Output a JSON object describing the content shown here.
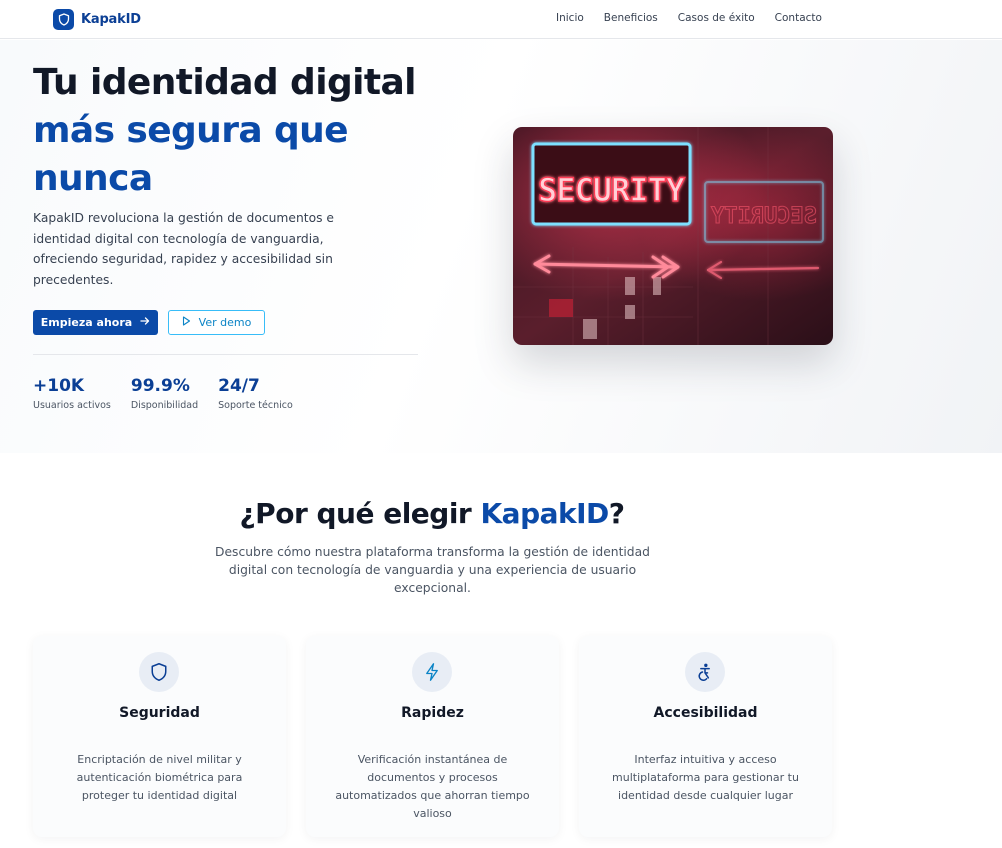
{
  "nav": {
    "brand": "KapakID",
    "links": [
      "Inicio",
      "Beneficios",
      "Casos de éxito",
      "Contacto"
    ]
  },
  "hero": {
    "title_line1": "Tu identidad digital",
    "title_line2": "más segura que",
    "title_line3": "nunca",
    "description": "KapakID revoluciona la gestión de documentos e identidad digital con tecnología de vanguardia, ofreciendo seguridad, rapidez y accesibilidad sin precedentes.",
    "primary_button": "Empieza ahora",
    "secondary_button": "Ver demo",
    "stats": [
      {
        "value": "+10K",
        "label": "Usuarios activos"
      },
      {
        "value": "99.9%",
        "label": "Disponibilidad"
      },
      {
        "value": "24/7",
        "label": "Soporte técnico"
      }
    ],
    "image_sign_text": "SECURITY"
  },
  "why": {
    "title_prefix": "¿Por qué elegir ",
    "title_brand": "KapakID",
    "title_suffix": "?",
    "description": "Descubre cómo nuestra plataforma transforma la gestión de identidad digital con tecnología de vanguardia y una experiencia de usuario excepcional."
  },
  "features": [
    {
      "icon": "shield-icon",
      "title": "Seguridad",
      "description": "Encriptación de nivel militar y autenticación biométrica para proteger tu identidad digital"
    },
    {
      "icon": "lightning-icon",
      "title": "Rapidez",
      "description": "Verificación instantánea de documentos y procesos automatizados que ahorran tiempo valioso"
    },
    {
      "icon": "accessibility-icon",
      "title": "Accesibilidad",
      "description": "Interfaz intuitiva y acceso multiplataforma para gestionar tu identidad desde cualquier lugar"
    }
  ],
  "colors": {
    "brand_blue": "#0b4aa8",
    "accent_cyan": "#38bdf8",
    "text_dark": "#111827"
  }
}
